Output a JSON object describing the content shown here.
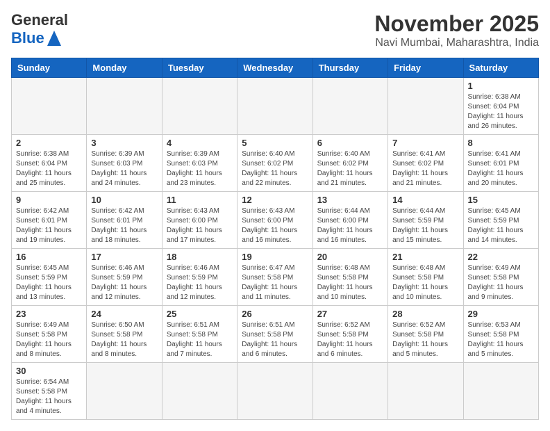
{
  "header": {
    "logo_general": "General",
    "logo_blue": "Blue",
    "month_title": "November 2025",
    "location": "Navi Mumbai, Maharashtra, India"
  },
  "weekdays": [
    "Sunday",
    "Monday",
    "Tuesday",
    "Wednesday",
    "Thursday",
    "Friday",
    "Saturday"
  ],
  "weeks": [
    [
      {
        "day": "",
        "info": ""
      },
      {
        "day": "",
        "info": ""
      },
      {
        "day": "",
        "info": ""
      },
      {
        "day": "",
        "info": ""
      },
      {
        "day": "",
        "info": ""
      },
      {
        "day": "",
        "info": ""
      },
      {
        "day": "1",
        "info": "Sunrise: 6:38 AM\nSunset: 6:04 PM\nDaylight: 11 hours\nand 26 minutes."
      }
    ],
    [
      {
        "day": "2",
        "info": "Sunrise: 6:38 AM\nSunset: 6:04 PM\nDaylight: 11 hours\nand 25 minutes."
      },
      {
        "day": "3",
        "info": "Sunrise: 6:39 AM\nSunset: 6:03 PM\nDaylight: 11 hours\nand 24 minutes."
      },
      {
        "day": "4",
        "info": "Sunrise: 6:39 AM\nSunset: 6:03 PM\nDaylight: 11 hours\nand 23 minutes."
      },
      {
        "day": "5",
        "info": "Sunrise: 6:40 AM\nSunset: 6:02 PM\nDaylight: 11 hours\nand 22 minutes."
      },
      {
        "day": "6",
        "info": "Sunrise: 6:40 AM\nSunset: 6:02 PM\nDaylight: 11 hours\nand 21 minutes."
      },
      {
        "day": "7",
        "info": "Sunrise: 6:41 AM\nSunset: 6:02 PM\nDaylight: 11 hours\nand 21 minutes."
      },
      {
        "day": "8",
        "info": "Sunrise: 6:41 AM\nSunset: 6:01 PM\nDaylight: 11 hours\nand 20 minutes."
      }
    ],
    [
      {
        "day": "9",
        "info": "Sunrise: 6:42 AM\nSunset: 6:01 PM\nDaylight: 11 hours\nand 19 minutes."
      },
      {
        "day": "10",
        "info": "Sunrise: 6:42 AM\nSunset: 6:01 PM\nDaylight: 11 hours\nand 18 minutes."
      },
      {
        "day": "11",
        "info": "Sunrise: 6:43 AM\nSunset: 6:00 PM\nDaylight: 11 hours\nand 17 minutes."
      },
      {
        "day": "12",
        "info": "Sunrise: 6:43 AM\nSunset: 6:00 PM\nDaylight: 11 hours\nand 16 minutes."
      },
      {
        "day": "13",
        "info": "Sunrise: 6:44 AM\nSunset: 6:00 PM\nDaylight: 11 hours\nand 16 minutes."
      },
      {
        "day": "14",
        "info": "Sunrise: 6:44 AM\nSunset: 5:59 PM\nDaylight: 11 hours\nand 15 minutes."
      },
      {
        "day": "15",
        "info": "Sunrise: 6:45 AM\nSunset: 5:59 PM\nDaylight: 11 hours\nand 14 minutes."
      }
    ],
    [
      {
        "day": "16",
        "info": "Sunrise: 6:45 AM\nSunset: 5:59 PM\nDaylight: 11 hours\nand 13 minutes."
      },
      {
        "day": "17",
        "info": "Sunrise: 6:46 AM\nSunset: 5:59 PM\nDaylight: 11 hours\nand 12 minutes."
      },
      {
        "day": "18",
        "info": "Sunrise: 6:46 AM\nSunset: 5:59 PM\nDaylight: 11 hours\nand 12 minutes."
      },
      {
        "day": "19",
        "info": "Sunrise: 6:47 AM\nSunset: 5:58 PM\nDaylight: 11 hours\nand 11 minutes."
      },
      {
        "day": "20",
        "info": "Sunrise: 6:48 AM\nSunset: 5:58 PM\nDaylight: 11 hours\nand 10 minutes."
      },
      {
        "day": "21",
        "info": "Sunrise: 6:48 AM\nSunset: 5:58 PM\nDaylight: 11 hours\nand 10 minutes."
      },
      {
        "day": "22",
        "info": "Sunrise: 6:49 AM\nSunset: 5:58 PM\nDaylight: 11 hours\nand 9 minutes."
      }
    ],
    [
      {
        "day": "23",
        "info": "Sunrise: 6:49 AM\nSunset: 5:58 PM\nDaylight: 11 hours\nand 8 minutes."
      },
      {
        "day": "24",
        "info": "Sunrise: 6:50 AM\nSunset: 5:58 PM\nDaylight: 11 hours\nand 8 minutes."
      },
      {
        "day": "25",
        "info": "Sunrise: 6:51 AM\nSunset: 5:58 PM\nDaylight: 11 hours\nand 7 minutes."
      },
      {
        "day": "26",
        "info": "Sunrise: 6:51 AM\nSunset: 5:58 PM\nDaylight: 11 hours\nand 6 minutes."
      },
      {
        "day": "27",
        "info": "Sunrise: 6:52 AM\nSunset: 5:58 PM\nDaylight: 11 hours\nand 6 minutes."
      },
      {
        "day": "28",
        "info": "Sunrise: 6:52 AM\nSunset: 5:58 PM\nDaylight: 11 hours\nand 5 minutes."
      },
      {
        "day": "29",
        "info": "Sunrise: 6:53 AM\nSunset: 5:58 PM\nDaylight: 11 hours\nand 5 minutes."
      }
    ],
    [
      {
        "day": "30",
        "info": "Sunrise: 6:54 AM\nSunset: 5:58 PM\nDaylight: 11 hours\nand 4 minutes."
      },
      {
        "day": "",
        "info": ""
      },
      {
        "day": "",
        "info": ""
      },
      {
        "day": "",
        "info": ""
      },
      {
        "day": "",
        "info": ""
      },
      {
        "day": "",
        "info": ""
      },
      {
        "day": "",
        "info": ""
      }
    ]
  ]
}
